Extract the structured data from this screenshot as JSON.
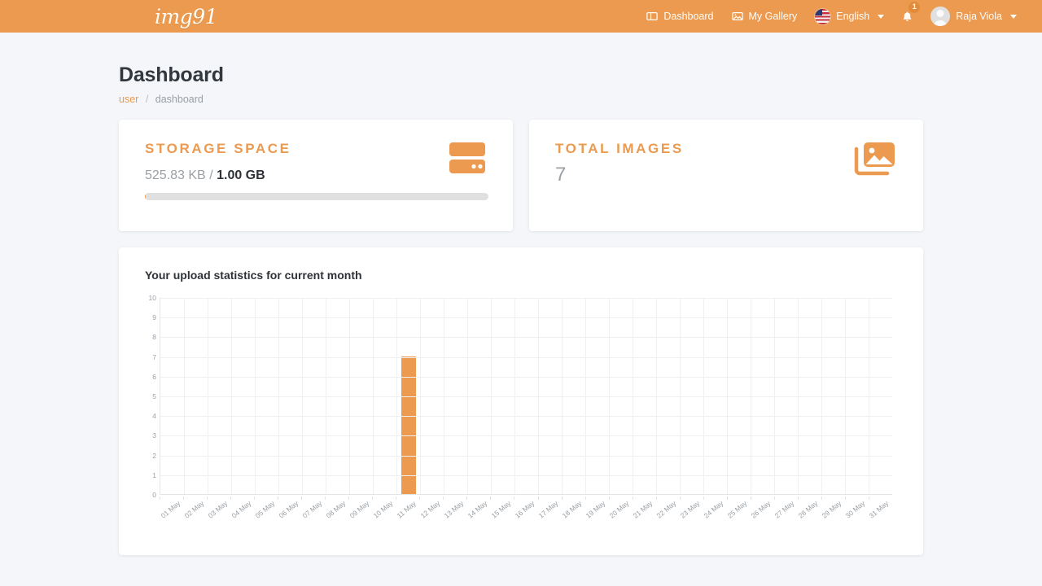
{
  "navbar": {
    "brand": "img91",
    "items": [
      {
        "label": "Dashboard",
        "icon": "columns-icon"
      },
      {
        "label": "My Gallery",
        "icon": "image-icon"
      }
    ],
    "language": {
      "label": "English",
      "icon": "us-flag-icon"
    },
    "notifications": {
      "count": "1",
      "icon": "bell-icon"
    },
    "user": {
      "name": "Raja Viola",
      "icon": "avatar-icon"
    }
  },
  "page": {
    "title": "Dashboard",
    "breadcrumb": {
      "root": "user",
      "separator": "/",
      "current": "dashboard"
    }
  },
  "cards": {
    "storage": {
      "title": "STORAGE SPACE",
      "used": "525.83 KB",
      "separator": "/",
      "total": "1.00 GB",
      "percent": 0.05,
      "icon": "server-icon"
    },
    "images": {
      "title": "TOTAL IMAGES",
      "value": "7",
      "icon": "photo-library-icon"
    }
  },
  "chart_data": {
    "type": "bar",
    "title": "Your upload statistics for current month",
    "xlabel": "",
    "ylabel": "",
    "ylim": [
      0,
      10
    ],
    "yticks": [
      0,
      1,
      2,
      3,
      4,
      5,
      6,
      7,
      8,
      9,
      10
    ],
    "grid": true,
    "legend": false,
    "bar_color": "#ec9a4f",
    "categories": [
      "01 May",
      "02 May",
      "03 May",
      "04 May",
      "05 May",
      "06 May",
      "07 May",
      "08 May",
      "09 May",
      "10 May",
      "11 May",
      "12 May",
      "13 May",
      "14 May",
      "15 May",
      "16 May",
      "17 May",
      "18 May",
      "19 May",
      "20 May",
      "21 May",
      "22 May",
      "23 May",
      "24 May",
      "25 May",
      "26 May",
      "27 May",
      "28 May",
      "29 May",
      "30 May",
      "31 May"
    ],
    "values": [
      0,
      0,
      0,
      0,
      0,
      0,
      0,
      0,
      0,
      0,
      7,
      0,
      0,
      0,
      0,
      0,
      0,
      0,
      0,
      0,
      0,
      0,
      0,
      0,
      0,
      0,
      0,
      0,
      0,
      0,
      0
    ]
  },
  "colors": {
    "accent": "#ec9a4f",
    "page_bg": "#f4f6f9",
    "card_bg": "#ffffff",
    "text_dark": "#2e3238",
    "text_muted": "#9aa0a6"
  }
}
